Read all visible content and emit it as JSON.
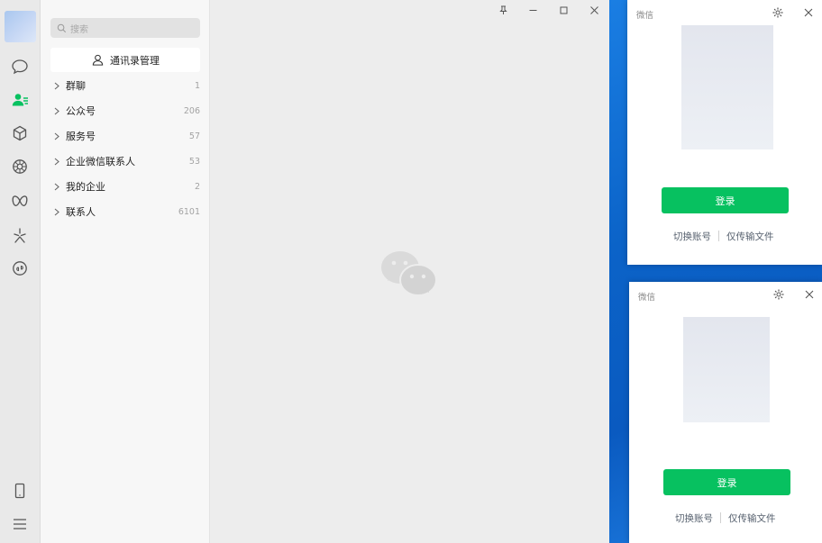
{
  "sidebar": {
    "icons": [
      "chat-icon",
      "contacts-icon",
      "favorites-icon",
      "moments-icon",
      "channels-icon",
      "search-discover-icon",
      "mini-programs-icon",
      "phone-icon",
      "menu-icon"
    ]
  },
  "contacts": {
    "search_placeholder": "搜索",
    "manage_label": "通讯录管理",
    "groups": [
      {
        "label": "群聊",
        "count": "1"
      },
      {
        "label": "公众号",
        "count": "206"
      },
      {
        "label": "服务号",
        "count": "57"
      },
      {
        "label": "企业微信联系人",
        "count": "53"
      },
      {
        "label": "我的企业",
        "count": "2"
      },
      {
        "label": "联系人",
        "count": "6101"
      }
    ]
  },
  "login_windows": [
    {
      "title": "微信",
      "login_label": "登录",
      "switch_label": "切换账号",
      "file_label": "仅传输文件"
    },
    {
      "title": "微信",
      "login_label": "登录",
      "switch_label": "切换账号",
      "file_label": "仅传输文件"
    }
  ],
  "colors": {
    "accent_green": "#07c160",
    "rail_active": "#07c160",
    "desktop_blue": "#0b63c8"
  }
}
